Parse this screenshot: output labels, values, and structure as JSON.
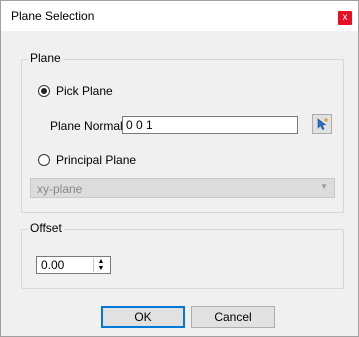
{
  "window": {
    "title": "Plane Selection",
    "close_label": "x"
  },
  "plane_group": {
    "title": "Plane",
    "pick_plane_label": "Pick Plane",
    "pick_plane_checked": true,
    "normal_label": "Plane Normal",
    "normal_value": "0 0 1",
    "principal_plane_label": "Principal Plane",
    "principal_plane_checked": false,
    "principal_select_value": "xy-plane"
  },
  "offset_group": {
    "title": "Offset",
    "value": "0.00"
  },
  "buttons": {
    "ok": "OK",
    "cancel": "Cancel"
  },
  "colors": {
    "close": "#e81123",
    "default_button_border": "#0078d7"
  }
}
